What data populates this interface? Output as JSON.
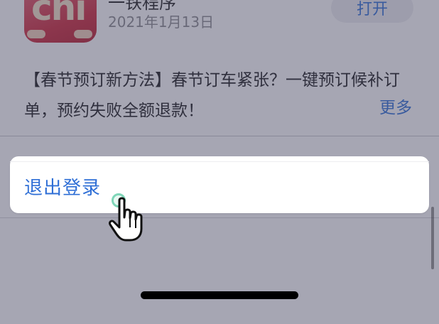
{
  "app": {
    "name": "一铁程序",
    "date": "2021年1月13日",
    "open_label": "打开",
    "icon_label": "chi"
  },
  "description": {
    "text": "【春节预订新方法】春节订车紧张？一键预订候补订单，预约失败全额退款！",
    "more_label": "更多"
  },
  "sheet": {
    "logout_label": "退出登录"
  },
  "colors": {
    "link": "#2f6fd6",
    "overlay": "#464460",
    "app_icon": "#cf2a3c",
    "tap_ring": "#7fd6b8"
  },
  "icons": {
    "cursor": "hand-pointer-icon"
  }
}
